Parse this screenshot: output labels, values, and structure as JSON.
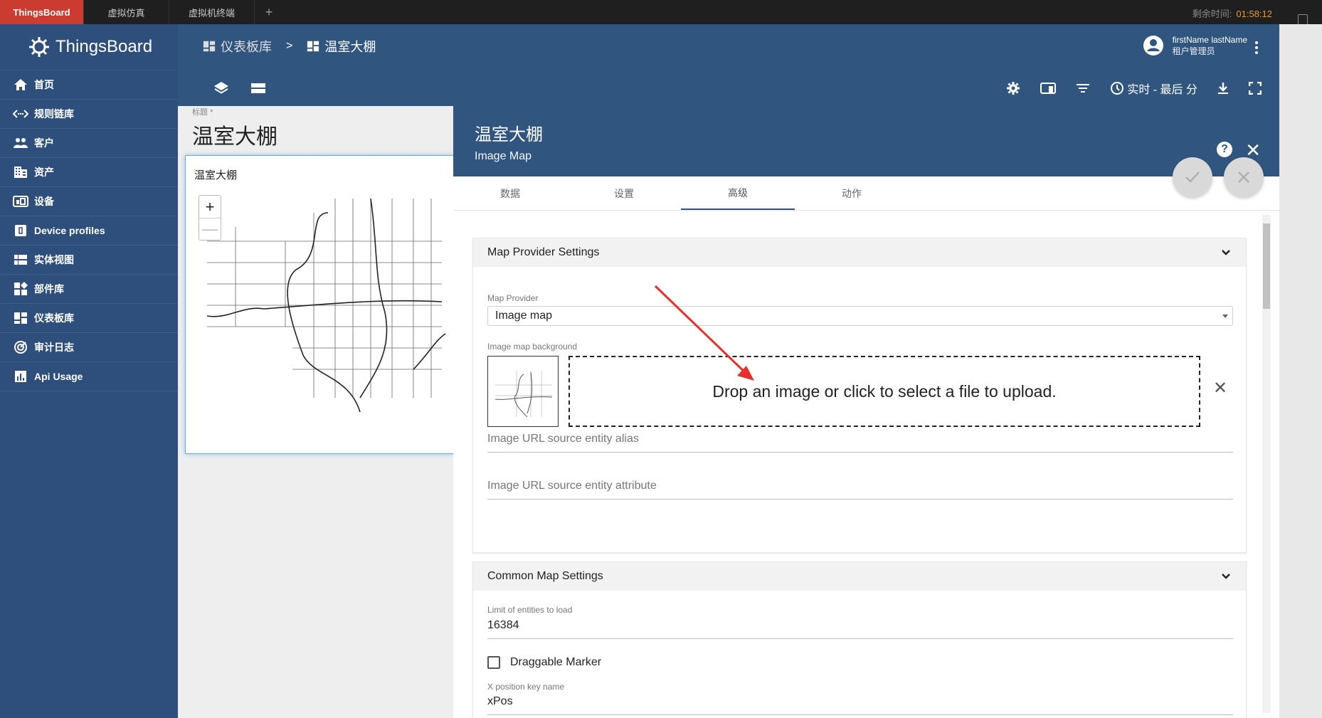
{
  "browser": {
    "tabs": [
      "ThingsBoard",
      "虚拟仿真",
      "虚拟机终端"
    ],
    "add_tab": "+",
    "timer_label": "剩余时间:",
    "timer_value": "01:58:12"
  },
  "sidebar": {
    "brand": "ThingsBoard",
    "items": [
      {
        "label": "首页",
        "icon": "home-icon"
      },
      {
        "label": "规则链库",
        "icon": "code-arrows-icon"
      },
      {
        "label": "客户",
        "icon": "people-icon"
      },
      {
        "label": "资产",
        "icon": "building-icon"
      },
      {
        "label": "设备",
        "icon": "device-icon"
      },
      {
        "label": "Device profiles",
        "icon": "device-profile-icon"
      },
      {
        "label": "实体视图",
        "icon": "entity-view-icon"
      },
      {
        "label": "部件库",
        "icon": "widgets-icon"
      },
      {
        "label": "仪表板库",
        "icon": "dashboard-icon"
      },
      {
        "label": "审计日志",
        "icon": "track-changes-icon"
      },
      {
        "label": "Api Usage",
        "icon": "bar-chart-icon"
      }
    ]
  },
  "header": {
    "breadcrumb": [
      "仪表板库",
      "温室大棚"
    ],
    "separator": ">",
    "user_name": "firstName lastName",
    "user_role": "租户管理员",
    "timewindow": "实时 - 最后 分"
  },
  "dashboard": {
    "label": "标题 *",
    "title": "温室大棚",
    "widget_title": "温室大棚",
    "zoom_in": "+",
    "zoom_out": "—"
  },
  "panel": {
    "title": "温室大棚",
    "subtitle": "Image Map",
    "help": "?",
    "close": "✕",
    "tabs": [
      "数据",
      "设置",
      "高级",
      "动作"
    ],
    "active_tab": "高级",
    "map_provider_section": {
      "title": "Map Provider Settings",
      "provider_label": "Map Provider",
      "provider_value": "Image map",
      "background_label": "Image map background",
      "dropzone_text": "Drop an image or click to select a file to upload.",
      "clear": "✕",
      "alias_placeholder": "Image URL source entity alias",
      "attribute_placeholder": "Image URL source entity attribute"
    },
    "common_section": {
      "title": "Common Map Settings",
      "limit_label": "Limit of entities to load",
      "limit_value": "16384",
      "draggable_label": "Draggable Marker",
      "xpos_label": "X position key name",
      "xpos_value": "xPos"
    }
  },
  "colors": {
    "sidebar": "#2e4f7c",
    "header": "#305680",
    "accent_tab": "#cc3b2f",
    "timer": "#e89a1f",
    "annotation_arrow": "#e8302a"
  }
}
